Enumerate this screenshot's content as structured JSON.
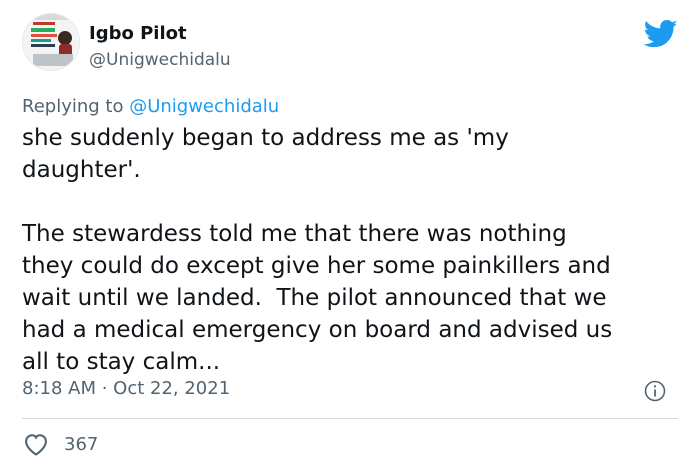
{
  "author": {
    "name": "Igbo Pilot",
    "handle": "@Unigwechidalu"
  },
  "reply": {
    "prefix": "Replying to ",
    "mention": "@Unigwechidalu"
  },
  "tweet": {
    "text": "she suddenly began to address me as 'my\ndaughter'.\n\nThe stewardess told me that there was nothing\nthey could do except give her some painkillers and\nwait until we landed.  The pilot announced that we\nhad a medical emergency on board and advised us\nall to stay calm...",
    "timestamp": "8:18 AM · Oct 22, 2021"
  },
  "engagement": {
    "likes": "367"
  },
  "icons": {
    "brand": "twitter-bird-icon",
    "info": "info-icon",
    "like": "heart-icon"
  },
  "colors": {
    "brand_blue": "#1d9bf0",
    "secondary_text": "#536471",
    "primary_text": "#0f1419"
  }
}
